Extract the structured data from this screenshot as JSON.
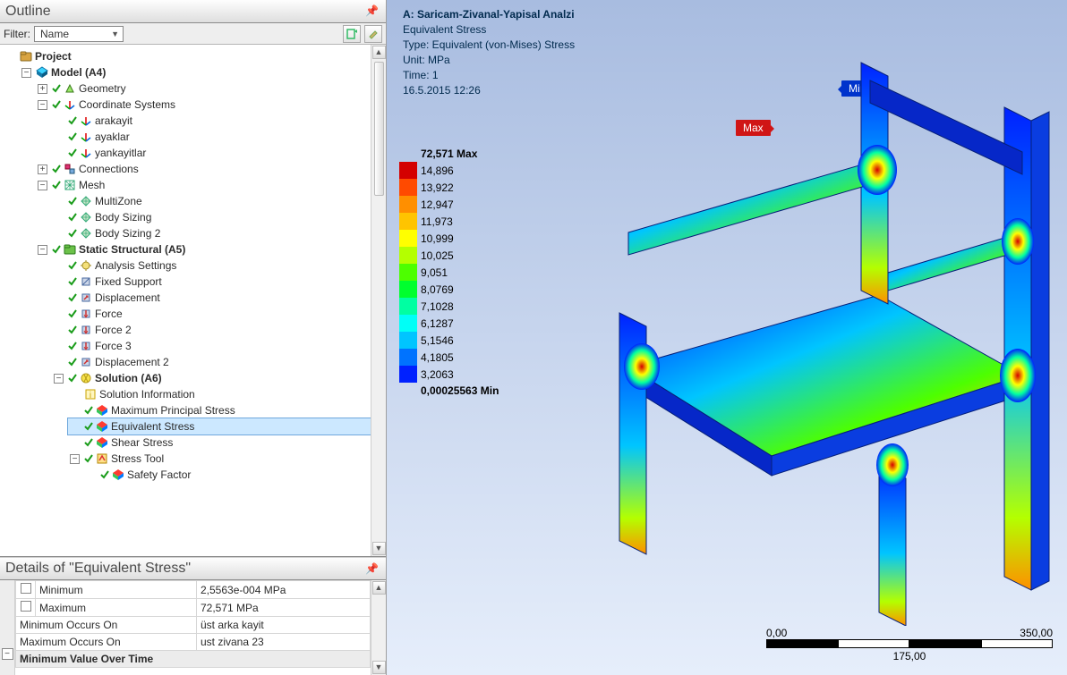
{
  "outline": {
    "title": "Outline",
    "filter_label": "Filter:",
    "filter_field": "Name"
  },
  "tree": {
    "project": "Project",
    "model": "Model (A4)",
    "geometry": "Geometry",
    "coord": "Coordinate Systems",
    "coord_items": [
      "arakayit",
      "ayaklar",
      "yankayitlar"
    ],
    "connections": "Connections",
    "mesh": "Mesh",
    "mesh_items": [
      "MultiZone",
      "Body Sizing",
      "Body Sizing 2"
    ],
    "static": "Static Structural (A5)",
    "analysis_settings": "Analysis Settings",
    "fixed_support": "Fixed Support",
    "displacement": "Displacement",
    "force": "Force",
    "force2": "Force 2",
    "force3": "Force 3",
    "displacement2": "Displacement 2",
    "solution": "Solution (A6)",
    "sol_info": "Solution Information",
    "max_princ": "Maximum Principal Stress",
    "eq_stress": "Equivalent Stress",
    "shear": "Shear Stress",
    "stress_tool": "Stress Tool",
    "safety": "Safety Factor"
  },
  "details": {
    "title": "Details of \"Equivalent Stress\"",
    "rows": {
      "min_k": "Minimum",
      "min_v": "2,5563e-004 MPa",
      "max_k": "Maximum",
      "max_v": "72,571 MPa",
      "minocc_k": "Minimum Occurs On",
      "minocc_v": "üst arka kayit",
      "maxocc_k": "Maximum Occurs On",
      "maxocc_v": "ust zivana 23"
    },
    "section": "Minimum Value Over Time"
  },
  "viewport": {
    "line_a": "A: Saricam-Zivanal-Yapisal Analzi",
    "line_b": "Equivalent Stress",
    "line_c": "Type: Equivalent (von-Mises) Stress",
    "line_d": "Unit: MPa",
    "line_e": "Time: 1",
    "line_f": "16.5.2015 12:26",
    "max_tag": "Max",
    "min_tag": "Min"
  },
  "legend": {
    "header": "72,571 Max",
    "footer": "0,00025563 Min",
    "items": [
      {
        "v": "14,896",
        "c": "#d40000"
      },
      {
        "v": "13,922",
        "c": "#ff4a00"
      },
      {
        "v": "12,947",
        "c": "#ff8f00"
      },
      {
        "v": "11,973",
        "c": "#ffc400"
      },
      {
        "v": "10,999",
        "c": "#ffff00"
      },
      {
        "v": "10,025",
        "c": "#b4ff00"
      },
      {
        "v": "9,051",
        "c": "#4dff00"
      },
      {
        "v": "8,0769",
        "c": "#00ff2e"
      },
      {
        "v": "7,1028",
        "c": "#00ffa2"
      },
      {
        "v": "6,1287",
        "c": "#00fff7"
      },
      {
        "v": "5,1546",
        "c": "#00c5ff"
      },
      {
        "v": "4,1805",
        "c": "#0073ff"
      },
      {
        "v": "3,2063",
        "c": "#0021ff"
      }
    ]
  },
  "scalebar": {
    "left": "0,00",
    "right": "350,00",
    "mid": "175,00"
  }
}
